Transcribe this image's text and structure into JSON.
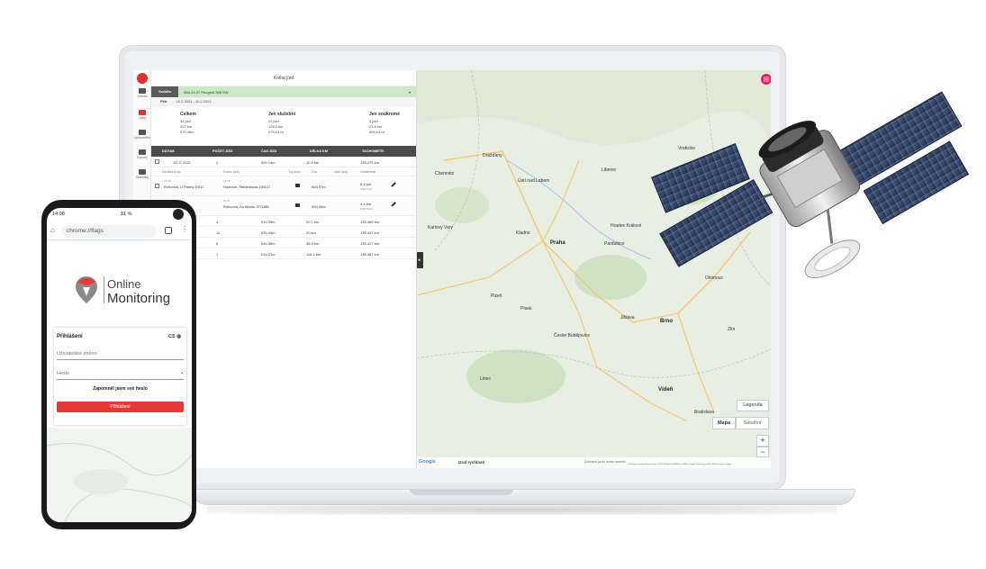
{
  "laptop_app": {
    "nav": {
      "items": [
        "Vozidla",
        "Jízdy",
        "Upozornění",
        "Exporty",
        "Statistiky"
      ]
    },
    "title": "Kniha jízd",
    "vehicle": {
      "label": "Vozidlo",
      "value": "068-13-37 Peugeot 308 SW"
    },
    "filter": {
      "label": "Filtr",
      "value": "10.2.2021 - 10.2.2021"
    },
    "summary": {
      "total": {
        "heading": "Celkem",
        "trips": "34 jízd",
        "distance": "207 km",
        "time": "07h 46m"
      },
      "business": {
        "heading": "Jen služební",
        "trips": "22 jízd",
        "distance": "128,2 km",
        "time": "07h 23 m"
      },
      "private": {
        "heading": "Jen soukromé",
        "trips": "3 jízd",
        "distance": "21,9 km",
        "time": "00h 23 m"
      }
    },
    "table": {
      "headers": [
        "DATUM",
        "POČET JÍZD",
        "ČAS JÍZD",
        "DÉLKA KM",
        "TACHOMETR"
      ],
      "first_row": {
        "date": "10. 2. 2021",
        "count": "2",
        "time": "00h 14m",
        "length": "10.4 km",
        "tacho": "135,479 km"
      },
      "subheaders": [
        "Začátek jízdy",
        "Konec jízdy",
        "Typ jízdy",
        "Čas",
        "Účel jízdy",
        "Vzdálenost"
      ],
      "trips": [
        {
          "start_time": "13:18",
          "start": "Rohcová, U Panny 5/311",
          "end_time": "13:25",
          "end": "Hodonín, Štefánikova 19/013",
          "time": "00h 07m",
          "dist": "5.4 km",
          "dist_sub": "135473 km"
        },
        {
          "start_time": "",
          "start": "...ny 3/963)",
          "end_time": "13:47",
          "end": "Rohcová, Za školou 37/1186",
          "time": "00h 06m",
          "dist": "4.4 km",
          "dist_sub": "135479 km"
        }
      ],
      "rows": [
        {
          "count": "4",
          "time": "01h 29m",
          "length": "20.7 km",
          "tacho": "135,465 km"
        },
        {
          "count": "11",
          "time": "03h 44m",
          "length": "20 km",
          "tacho": "135,447 km"
        },
        {
          "count": "6",
          "time": "04h 38m",
          "length": "38.9 km",
          "tacho": "135,427 km"
        },
        {
          "count": "1",
          "time": "01h 21m",
          "length": "116.1 km",
          "tacho": "135,387 km"
        }
      ]
    },
    "map": {
      "labels": [
        "Drážďany",
        "Praha",
        "Plzeň",
        "Brno",
        "Pardubice",
        "Liberec",
        "Chemnitz",
        "Jihlava",
        "České Budějovice",
        "Olomouc",
        "Bratislava",
        "Zlín",
        "Vratislav",
        "Hradec Králové",
        "Kladno",
        "Písek",
        "Vídeň",
        "Linec",
        "Ústí nad Labem",
        "Karlovy Vary"
      ],
      "legend_button": "Legenda",
      "type_map": "Mapa",
      "type_satellite": "Satelitní",
      "zoom_in": "+",
      "zoom_out": "−",
      "speed_chart": "Graf rychlosti",
      "google": "Google",
      "footer_note": "Zobrazit jízdu mimo období",
      "attribution": "Klávesové zkratky   Mapová data ©2022 GeoBasis-DE/BKG (©2009), Google   Podmínky použití   Nahlásit chybu v mapě"
    }
  },
  "phone": {
    "status_time": "14:08",
    "status_right": "81 %",
    "url": "chrome://flags",
    "logo_line1": "Online",
    "logo_line2": "Monitoring",
    "login": {
      "title": "Přihlášení",
      "lang": "CS",
      "username_placeholder": "Uživatelské jméno",
      "password_placeholder": "Heslo",
      "remember": "Zapomněl jsem své heslo",
      "button": "Přihlášení"
    }
  },
  "colors": {
    "brand_red": "#e53935",
    "vehicle_green": "#cde8c9",
    "header_dark": "#4a4a4a"
  }
}
